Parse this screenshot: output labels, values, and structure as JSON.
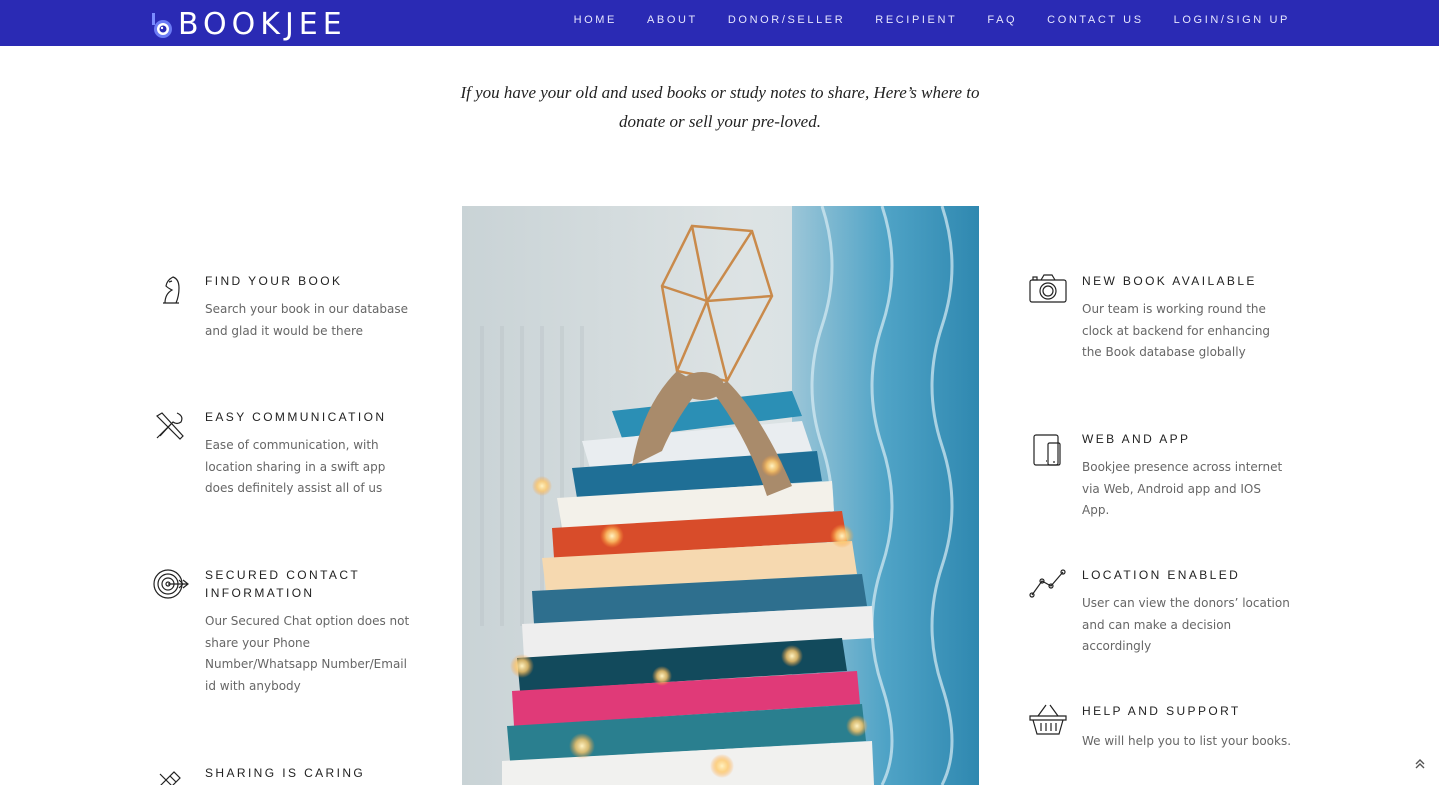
{
  "brand": {
    "name": "BOOKJEE",
    "header_color": "#2a2ab4"
  },
  "nav": {
    "items": [
      {
        "label": "HOME"
      },
      {
        "label": "ABOUT"
      },
      {
        "label": "DONOR/SELLER"
      },
      {
        "label": "RECIPIENT"
      },
      {
        "label": "FAQ"
      },
      {
        "label": "CONTACT US"
      },
      {
        "label": "LOGIN/SIGN UP"
      }
    ]
  },
  "tagline": {
    "line1": "If you have your old and used books or study notes to share, Here’s where to",
    "line2": "donate or sell your pre-loved."
  },
  "features_left": [
    {
      "icon": "chess-knight-icon",
      "title": "FIND YOUR BOOK",
      "desc": "Search your book in our database and glad it would be there"
    },
    {
      "icon": "tools-icon",
      "title": "EASY COMMUNICATION",
      "desc": "Ease of communication, with location sharing in a swift app does definitely assist all of us"
    },
    {
      "icon": "target-icon",
      "title": "SECURED CONTACT INFORMATION",
      "desc": "Our Secured Chat option does not share your Phone Number/Whatsapp Number/Email id with anybody"
    },
    {
      "icon": "pencil-ruler-icon",
      "title": "SHARING IS CARING",
      "desc": ""
    }
  ],
  "features_right": [
    {
      "icon": "camera-icon",
      "title": "NEW BOOK AVAILABLE",
      "desc": "Our team is working round the clock at backend for enhancing the Book database globally"
    },
    {
      "icon": "tablet-phone-icon",
      "title": "WEB AND APP",
      "desc": "Bookjee presence across internet via Web, Android app and IOS App."
    },
    {
      "icon": "line-chart-icon",
      "title": "LOCATION ENABLED",
      "desc": "User can view the donors’ location and can make a decision accordingly"
    },
    {
      "icon": "basket-icon",
      "title": "HELP AND SUPPORT",
      "desc": "We will help you to list your books."
    }
  ],
  "scroll_top": {
    "icon": "double-chevron-up-icon",
    "glyph": "⌃"
  }
}
